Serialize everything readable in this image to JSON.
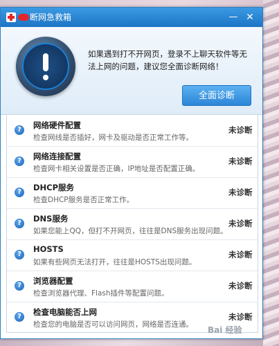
{
  "window": {
    "title": "断网急救箱",
    "minimize_glyph": "—",
    "close_glyph": "✕"
  },
  "header": {
    "intro": "如果遇到打不开网页，登录不上聊天软件等无法上网的问题，建议您全面诊断网络！",
    "diagnose_all_label": "全面诊断"
  },
  "items": [
    {
      "title": "网络硬件配置",
      "description": "检查网线是否插好，网卡及驱动是否正常工作等。",
      "status": "未诊断"
    },
    {
      "title": "网络连接配置",
      "description": "检查网卡相关设置是否正确，IP地址是否配置正确。",
      "status": "未诊断"
    },
    {
      "title": "DHCP服务",
      "description": "检查DHCP服务是否正常工作。",
      "status": "未诊断"
    },
    {
      "title": "DNS服务",
      "description": "如果您能上QQ，但打不开网页，往往是DNS服务出现问题。",
      "status": "未诊断"
    },
    {
      "title": "HOSTS",
      "description": "如果有些网页无法打开，往往是HOSTS出现问题。",
      "status": "未诊断"
    },
    {
      "title": "浏览器配置",
      "description": "检查浏览器代理、Flash插件等配置问题。",
      "status": "未诊断"
    },
    {
      "title": "检查电脑能否上网",
      "description": "检查您的电脑是否可以访问网页，网络是否连通。",
      "status": "未诊断"
    }
  ],
  "icons": {
    "app": "red-cross-icon",
    "alert": "exclamation-icon",
    "row": "question-mark-icon"
  },
  "watermark": "Bai 经验",
  "colors": {
    "titlebar": "#1c74c5",
    "accent_button": "#2c86d8",
    "brand_red": "#e3262b"
  }
}
